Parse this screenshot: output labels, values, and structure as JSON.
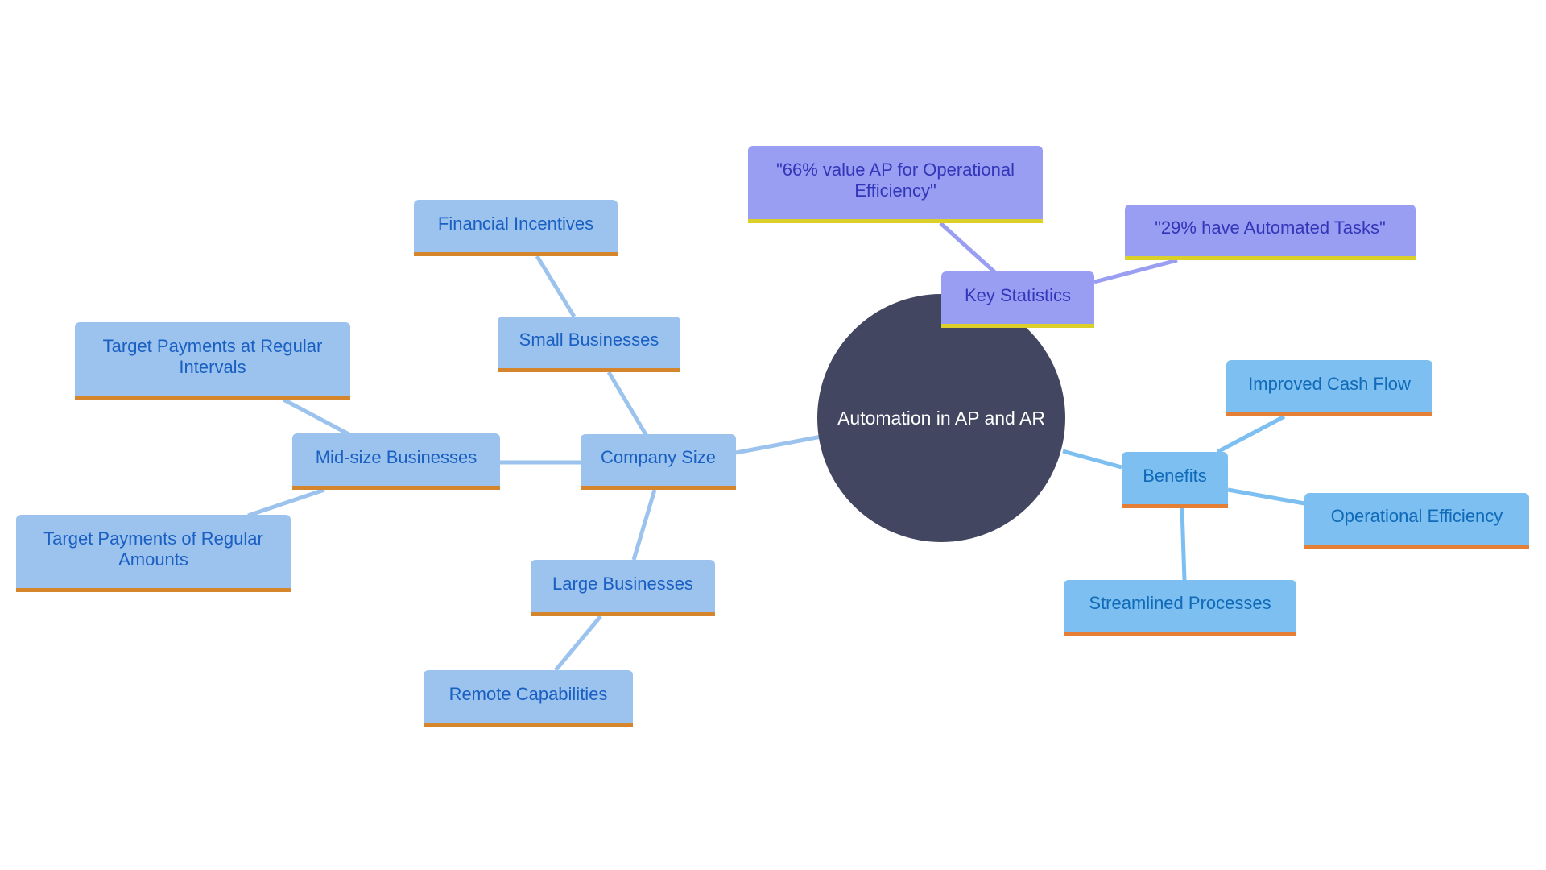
{
  "root": {
    "label": "Automation in AP and AR",
    "color": "#424660"
  },
  "branches": {
    "company_size": {
      "label": "Company Size",
      "children": {
        "small": {
          "label": "Small Businesses",
          "children": {
            "financial": {
              "label": "Financial Incentives"
            }
          }
        },
        "mid": {
          "label": "Mid-size Businesses",
          "children": {
            "intervals": {
              "label": "Target Payments at Regular Intervals"
            },
            "amounts": {
              "label": "Target Payments of Regular Amounts"
            }
          }
        },
        "large": {
          "label": "Large Businesses",
          "children": {
            "remote": {
              "label": "Remote Capabilities"
            }
          }
        }
      }
    },
    "benefits": {
      "label": "Benefits",
      "children": {
        "cash_flow": {
          "label": "Improved Cash Flow"
        },
        "op_eff": {
          "label": "Operational Efficiency"
        },
        "streamlined": {
          "label": "Streamlined Processes"
        }
      }
    },
    "key_statistics": {
      "label": "Key Statistics",
      "children": {
        "stat66": {
          "label": "\"66% value AP for Operational Efficiency\""
        },
        "stat29": {
          "label": "\"29% have Automated Tasks\""
        }
      }
    }
  },
  "colors": {
    "company_fill": "#9bc3ee",
    "company_text": "#1a5fc2",
    "company_edge": "#9bc3ee",
    "benefit_fill": "#7cbff0",
    "benefit_text": "#106ab8",
    "benefit_edge": "#7cbff0",
    "stat_fill": "#9a9ef2",
    "stat_text": "#3236b8",
    "stat_edge": "#9a9ef2",
    "underline_orange": "#d5852b",
    "underline_yellow": "#dbcf2a"
  }
}
